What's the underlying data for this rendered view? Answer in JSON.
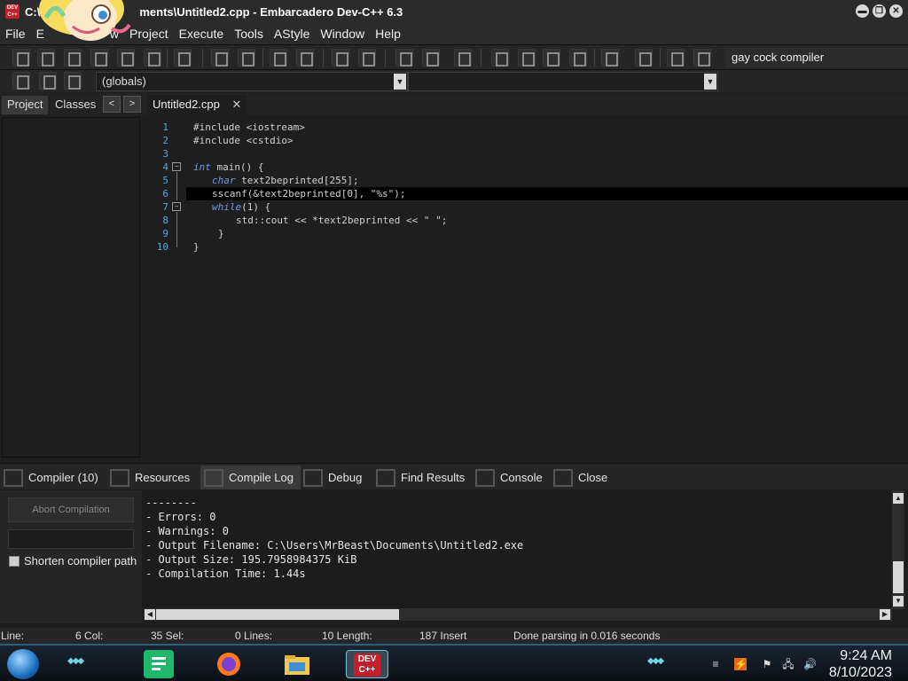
{
  "window": {
    "title_left": "C:\\",
    "title_right": "ments\\Untitled2.cpp - Embarcadero Dev-C++ 6.3",
    "app_icon_text": "DEV C++",
    "controls": [
      "▬",
      "❐",
      "✕"
    ]
  },
  "menu": [
    "File",
    "E",
    "w",
    "Project",
    "Execute",
    "Tools",
    "AStyle",
    "Window",
    "Help"
  ],
  "toolbar": {
    "compiler_selector": "gay cock compiler",
    "scope_combo": "(globals)",
    "function_combo": "",
    "dropdown_glyph": "▼"
  },
  "left_panel": {
    "tabs": [
      "Project",
      "Classes"
    ],
    "nav_prev": "<",
    "nav_next": ">"
  },
  "editor": {
    "tab_label": "Untitled2.cpp",
    "tab_close": "✕",
    "line_numbers": [
      "1",
      "2",
      "3",
      "4",
      "5",
      "6",
      "7",
      "8",
      "9",
      "10"
    ],
    "fold_marker": "−",
    "lines": [
      "#include <iostream>",
      "#include <cstdio>",
      "",
      "int main() {",
      "char text2beprinted[255];",
      "sscanf(&text2beprinted[0], \"%s\");",
      "while(1) {",
      "std::cout << *text2beprinted << \" \";",
      "}",
      "}"
    ],
    "current_line": 6
  },
  "bottom_panel": {
    "tabs": [
      "Compiler (10)",
      "Resources",
      "Compile Log",
      "Debug",
      "Find Results",
      "Console",
      "Close"
    ],
    "active_tab": "Compile Log",
    "abort_button": "Abort Compilation",
    "shorten_path_label": "Shorten compiler path",
    "shorten_path_checked": false,
    "log_lines": [
      "--------",
      "- Errors: 0",
      "- Warnings: 0",
      "- Output Filename: C:\\Users\\MrBeast\\Documents\\Untitled2.exe",
      "- Output Size: 195.7958984375 KiB",
      "- Compilation Time: 1.44s"
    ],
    "scroll_up": "▲",
    "scroll_down": "▼",
    "scroll_left": "◀",
    "scroll_right": "▶"
  },
  "status_bar": {
    "line_label": "Line:",
    "line_value": "6 Col:",
    "col_value": "35 Sel:",
    "sel_value": "0 Lines:",
    "lines_value": "10 Length:",
    "length_value": "187 Insert",
    "message": "Done parsing in 0.016 seconds"
  },
  "taskbar": {
    "app_label": "DEV C++",
    "time": "9:24 AM",
    "date": "8/10/2023"
  },
  "colors": {
    "keyword": "#6f97e8",
    "line_number": "#5aa7d6",
    "accent": "#2a5f75",
    "dev_icon": "#c21f2b"
  }
}
